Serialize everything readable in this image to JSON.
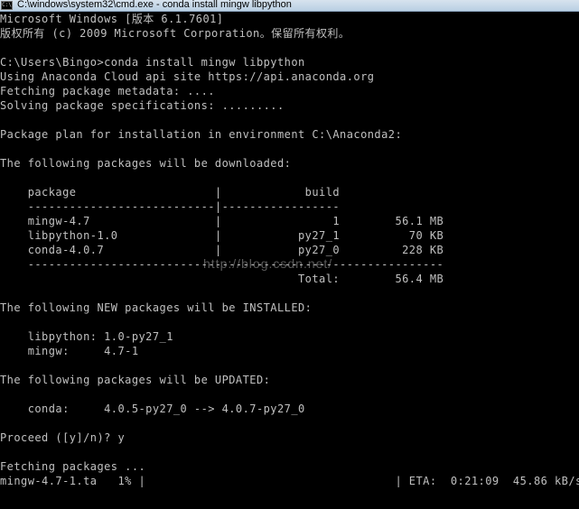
{
  "window": {
    "title": "C:\\windows\\system32\\cmd.exe - conda  install mingw libpython",
    "icon": "cmd-icon",
    "icon_text": "C:\\"
  },
  "console": {
    "lines": [
      "Microsoft Windows [版本 6.1.7601]",
      "版权所有 (c) 2009 Microsoft Corporation。保留所有权利。",
      "",
      "C:\\Users\\Bingo>conda install mingw libpython",
      "Using Anaconda Cloud api site https://api.anaconda.org",
      "Fetching package metadata: ....",
      "Solving package specifications: .........",
      "",
      "Package plan for installation in environment C:\\Anaconda2:",
      "",
      "The following packages will be downloaded:",
      "",
      "    package                    |            build",
      "    ---------------------------|-----------------",
      "    mingw-4.7                  |                1        56.1 MB",
      "    libpython-1.0              |           py27_1          70 KB",
      "    conda-4.0.7                |           py27_0         228 KB",
      "    ------------------------------------------------------------",
      "                                           Total:        56.4 MB",
      "",
      "The following NEW packages will be INSTALLED:",
      "",
      "    libpython: 1.0-py27_1",
      "    mingw:     4.7-1",
      "",
      "The following packages will be UPDATED:",
      "",
      "    conda:     4.0.5-py27_0 --> 4.0.7-py27_0",
      "",
      "Proceed ([y]/n)? y",
      "",
      "Fetching packages ...",
      "mingw-4.7-1.ta   1% |                                    | ETA:  0:21:09  45.86 kB/s"
    ]
  },
  "watermark": "http://blog.csdn.net/"
}
